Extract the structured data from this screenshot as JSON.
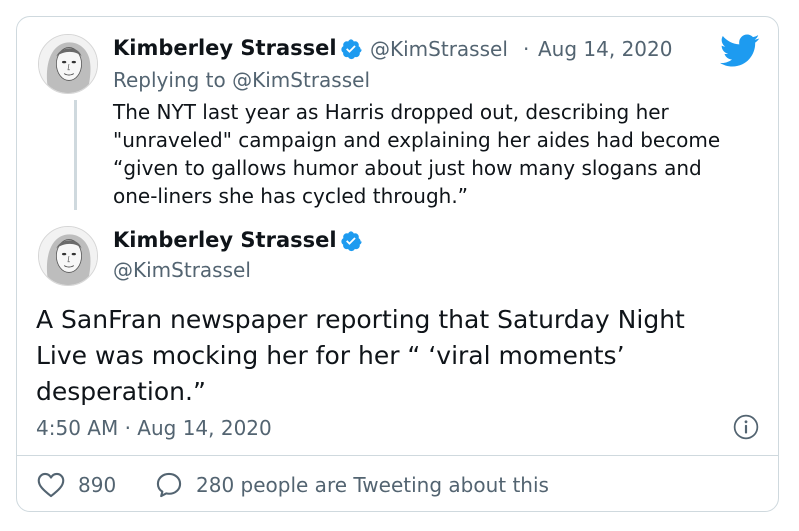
{
  "quoted_tweet": {
    "author_name": "Kimberley Strassel",
    "author_handle": "@KimStrassel",
    "separator": "·",
    "date": "Aug 14, 2020",
    "replying_to_prefix": "Replying to",
    "replying_to_handle": "@KimStrassel",
    "text_lines": [
      "The NYT last year as Harris dropped out, describing her",
      "\"unraveled\" campaign and explaining her aides had become",
      "“given to gallows humor about just how many slogans and",
      "one-liners she has cycled through.”"
    ]
  },
  "main_tweet": {
    "author_name": "Kimberley Strassel",
    "author_handle": "@KimStrassel",
    "text_lines": [
      "A SanFran newspaper reporting that Saturday Night",
      "Live was mocking her for her “ ‘viral moments’",
      "desperation.”"
    ],
    "timestamp": "4:50 AM · Aug 14, 2020"
  },
  "stats": {
    "likes": "890",
    "conversation": "280 people are Tweeting about this"
  },
  "icons": {
    "brand": "twitter-bird-icon",
    "verified": "verified-badge-icon",
    "info": "info-icon",
    "like": "heart-icon",
    "reply": "speech-bubble-icon"
  },
  "colors": {
    "brand_blue": "#1d9bf0",
    "text": "#0f1419",
    "muted": "#536471",
    "border": "#cfd9de"
  }
}
